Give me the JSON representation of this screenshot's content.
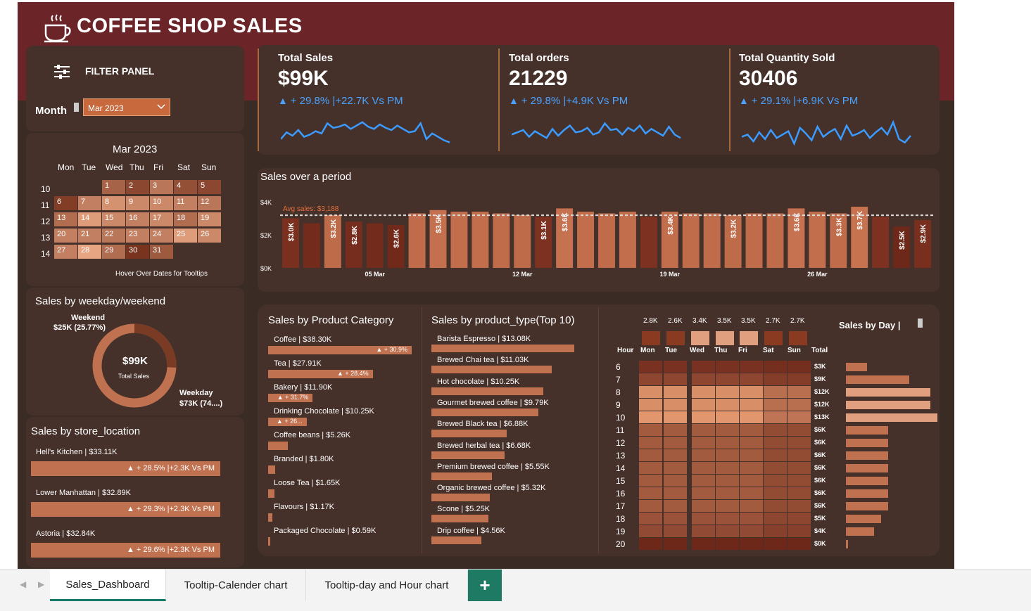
{
  "title": "COFFEE SHOP SALES",
  "filter": {
    "heading": "FILTER PANEL",
    "month_label": "Month",
    "month_value": "Mar 2023",
    "calendar_title": "Mar 2023",
    "weekdays": [
      "Mon",
      "Tue",
      "Wed",
      "Thu",
      "Fri",
      "Sat",
      "Sun"
    ],
    "weeks": [
      "10",
      "11",
      "12",
      "13",
      "14"
    ],
    "hint": "Hover Over Dates for Tooltips"
  },
  "kpis": [
    {
      "label": "Total Sales",
      "value": "$99K",
      "delta": "+ 29.8% |+22.7K Vs PM"
    },
    {
      "label": "Total orders",
      "value": "21229",
      "delta": "+ 29.8% |+4.9K Vs PM"
    },
    {
      "label": "Total Quantity Sold",
      "value": "30406",
      "delta": "+ 29.1% |+6.9K Vs PM"
    }
  ],
  "weekday_weekend": {
    "heading": "Sales by weekday/weekend",
    "weekend_label": "Weekend",
    "weekend_value": "$25K (25.77%)",
    "weekday_label": "Weekday",
    "weekday_value": "$73K (74....)",
    "center_value": "$99K",
    "center_label": "Total Sales",
    "weekend_fraction": 0.2577
  },
  "store": {
    "heading": "Sales by store_location",
    "items": [
      {
        "label": "Hell's Kitchen | $33.11K",
        "delta": "+ 28.5% |+2.3K Vs PM"
      },
      {
        "label": "Lower Manhattan | $32.89K",
        "delta": "+ 29.3% |+2.3K Vs PM"
      },
      {
        "label": "Astoria | $32.84K",
        "delta": "+ 29.6% |+2.3K Vs PM"
      }
    ]
  },
  "period": {
    "heading": "Sales over a period",
    "avg_label": "Avg sales: $3,188"
  },
  "category": {
    "heading": "Sales by Product Category",
    "items": [
      {
        "label": "Coffee | $38.30K",
        "value": 38.3,
        "delta": "+ 30.9%"
      },
      {
        "label": "Tea | $27.91K",
        "value": 27.91,
        "delta": "+ 28.4%"
      },
      {
        "label": "Bakery | $11.90K",
        "value": 11.9,
        "delta": "+ 31.7%"
      },
      {
        "label": "Drinking Chocolate | $10.25K",
        "value": 10.25,
        "delta": "+ 26..."
      },
      {
        "label": "Coffee beans | $5.26K",
        "value": 5.26,
        "delta": ""
      },
      {
        "label": "Branded | $1.80K",
        "value": 1.8,
        "delta": ""
      },
      {
        "label": "Loose Tea | $1.65K",
        "value": 1.65,
        "delta": ""
      },
      {
        "label": "Flavours | $1.17K",
        "value": 1.17,
        "delta": ""
      },
      {
        "label": "Packaged Chocolate | $0.59K",
        "value": 0.59,
        "delta": ""
      }
    ]
  },
  "product_type": {
    "heading": "Sales by product_type(Top 10)",
    "items": [
      {
        "label": "Barista Espresso | $13.08K",
        "value": 13.08
      },
      {
        "label": "Brewed Chai tea | $11.03K",
        "value": 11.03
      },
      {
        "label": "Hot chocolate | $10.25K",
        "value": 10.25
      },
      {
        "label": "Gourmet brewed coffee | $9.79K",
        "value": 9.79
      },
      {
        "label": "Brewed Black tea | $6.88K",
        "value": 6.88
      },
      {
        "label": "Brewed herbal tea | $6.68K",
        "value": 6.68
      },
      {
        "label": "Premium brewed coffee | $5.55K",
        "value": 5.55
      },
      {
        "label": "Organic brewed coffee | $5.32K",
        "value": 5.32
      },
      {
        "label": "Scone | $5.25K",
        "value": 5.25
      },
      {
        "label": "Drip coffee | $4.56K",
        "value": 4.56
      }
    ]
  },
  "heatmap": {
    "heading": "Sales by Day |",
    "hour_label": "Hour",
    "total_label": "Total"
  },
  "tabs": [
    "Sales_Dashboard",
    "Tooltip-Calender chart",
    "Tooltip-day and Hour chart"
  ],
  "chart_data": [
    {
      "type": "bar",
      "title": "Sales over a period",
      "categories": [
        "1",
        "2",
        "3",
        "4",
        "5",
        "6",
        "7",
        "8",
        "9",
        "10",
        "11",
        "12",
        "13",
        "14",
        "15",
        "16",
        "17",
        "18",
        "19",
        "20",
        "21",
        "22",
        "23",
        "24",
        "25",
        "26",
        "27",
        "28",
        "29",
        "30",
        "31"
      ],
      "values": [
        3.0,
        2.7,
        3.2,
        2.8,
        2.7,
        2.6,
        3.3,
        3.5,
        3.4,
        3.4,
        3.3,
        3.2,
        3.1,
        3.6,
        3.4,
        3.3,
        3.4,
        3.1,
        3.4,
        3.3,
        3.3,
        3.2,
        3.3,
        3.3,
        3.6,
        3.4,
        3.3,
        3.7,
        3.1,
        2.5,
        2.9
      ],
      "labels": [
        "$3.0K",
        "",
        "$3.2K",
        "$2.8K",
        "",
        "$2.6K",
        "",
        "$3.5K",
        "",
        "",
        "",
        "",
        "$3.1K",
        "$3.6K",
        "",
        "",
        "",
        "",
        "$3.4K",
        "",
        "",
        "$3.2K",
        "",
        "",
        "$3.6K",
        "",
        "$3.3K",
        "$3.7K",
        "",
        "$2.5K",
        "$2.9K"
      ],
      "x_ticks": [
        "05 Mar",
        "12 Mar",
        "19 Mar",
        "26 Mar"
      ],
      "y_ticks": [
        "$0K",
        "$2K",
        "$4K"
      ],
      "ylim": [
        0,
        4
      ],
      "average": 3.188
    },
    {
      "type": "bar",
      "title": "Sales by Day |",
      "categories": [
        "Mon",
        "Tue",
        "Wed",
        "Thu",
        "Fri",
        "Sat",
        "Sun"
      ],
      "values": [
        2.8,
        2.6,
        3.4,
        3.5,
        3.5,
        2.7,
        2.7
      ],
      "labels": [
        "2.8K",
        "2.6K",
        "3.4K",
        "3.5K",
        "3.5K",
        "2.7K",
        "2.7K"
      ]
    },
    {
      "type": "heatmap",
      "hours": [
        "6",
        "7",
        "8",
        "9",
        "10",
        "11",
        "12",
        "13",
        "14",
        "15",
        "16",
        "17",
        "18",
        "19",
        "20"
      ],
      "hour_totals": [
        3,
        9,
        12,
        12,
        13,
        6,
        6,
        6,
        6,
        6,
        6,
        6,
        5,
        4,
        0
      ],
      "hour_total_labels": [
        "$3K",
        "$9K",
        "$12K",
        "$12K",
        "$13K",
        "$6K",
        "$6K",
        "$6K",
        "$6K",
        "$6K",
        "$6K",
        "$6K",
        "$5K",
        "$4K",
        "$0K"
      ]
    }
  ]
}
